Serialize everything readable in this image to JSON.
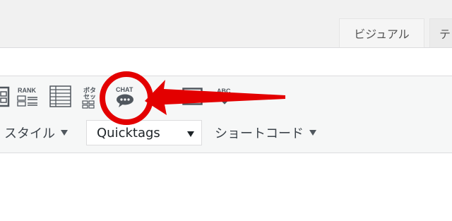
{
  "tabs": [
    {
      "label": "ビジュアル"
    },
    {
      "label": "テ"
    }
  ],
  "toolbar": {
    "rank_label": "RANK",
    "button_label_line1": "ボタ",
    "button_label_line2": "セッ",
    "chat_label": "CHAT",
    "spell_label": "ABC",
    "style_label": "スタイル",
    "quicktags_value": "Quicktags",
    "shortcode_label": "ショートコード"
  },
  "colors": {
    "annotation": "#e30000",
    "toolbar_bg": "#f6f7f7",
    "icon": "#50575e"
  }
}
